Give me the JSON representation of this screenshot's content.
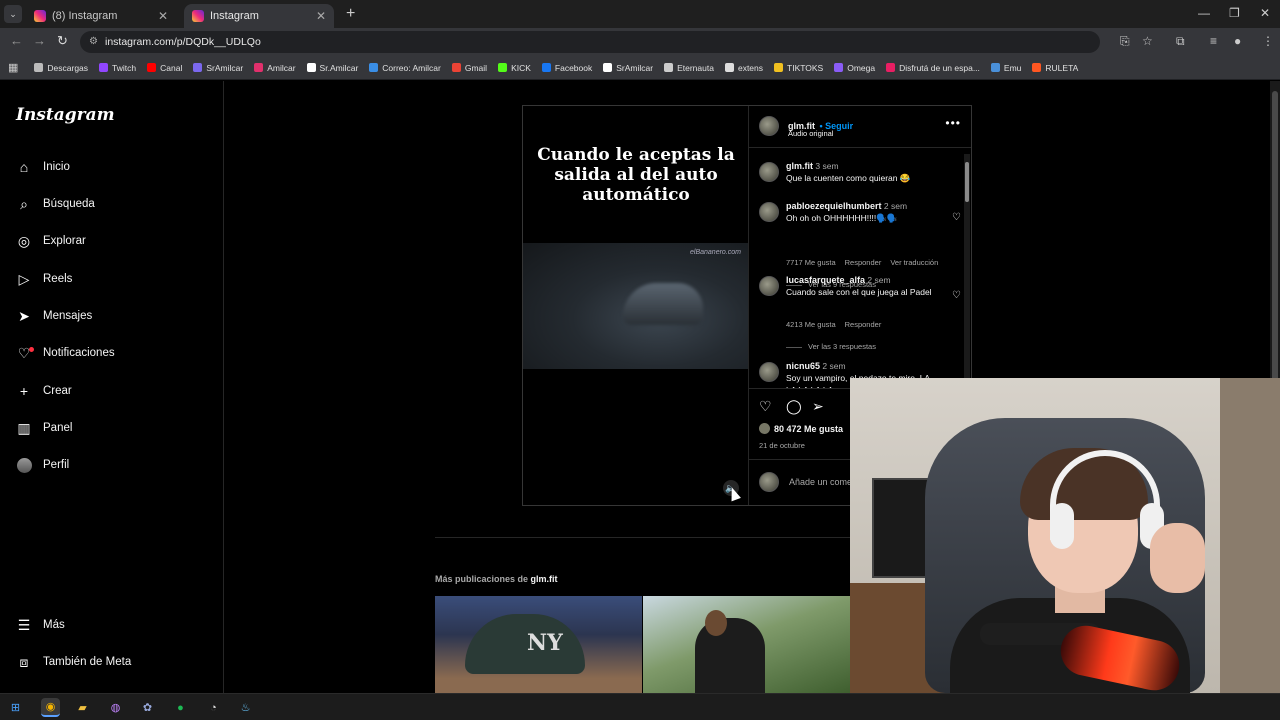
{
  "browser": {
    "tabs": [
      {
        "label": "(8) Instagram",
        "active": false
      },
      {
        "label": "Instagram",
        "active": true
      }
    ],
    "url": "instagram.com/p/DQDk__UDLQo",
    "bookmarks": [
      {
        "label": "Descargas",
        "color": "#bbbbbb"
      },
      {
        "label": "Twitch",
        "color": "#9146ff"
      },
      {
        "label": "Canal",
        "color": "#ff0000"
      },
      {
        "label": "SrAmilcar",
        "color": "#7b68ee"
      },
      {
        "label": "Amilcar",
        "color": "#e1306c"
      },
      {
        "label": "Sr.Amilcar",
        "color": "#ffffff"
      },
      {
        "label": "Correo: Amilcar",
        "color": "#3a8ee6"
      },
      {
        "label": "Gmail",
        "color": "#ea4335"
      },
      {
        "label": "KICK",
        "color": "#53fc18"
      },
      {
        "label": "Facebook",
        "color": "#1877f2"
      },
      {
        "label": "SrAmilcar",
        "color": "#ffffff"
      },
      {
        "label": "Eternauta",
        "color": "#cccccc"
      },
      {
        "label": "extens",
        "color": "#dddddd"
      },
      {
        "label": "TIKTOKS",
        "color": "#f0c020"
      },
      {
        "label": "Omega",
        "color": "#8a5cf6"
      },
      {
        "label": "Disfrutá de un espa...",
        "color": "#e91e63"
      },
      {
        "label": "Emu",
        "color": "#4a90d9"
      },
      {
        "label": "RULETA",
        "color": "#ff5722"
      }
    ]
  },
  "sidebar": {
    "logo": "Instagram",
    "items": [
      {
        "label": "Inicio",
        "icon": "home-icon",
        "glyph": "⌂"
      },
      {
        "label": "Búsqueda",
        "icon": "search-icon",
        "glyph": "⌕"
      },
      {
        "label": "Explorar",
        "icon": "compass-icon",
        "glyph": "◎"
      },
      {
        "label": "Reels",
        "icon": "reels-icon",
        "glyph": "▷"
      },
      {
        "label": "Mensajes",
        "icon": "messenger-icon",
        "glyph": "➤"
      },
      {
        "label": "Notificaciones",
        "icon": "heart-icon",
        "glyph": "♡"
      },
      {
        "label": "Crear",
        "icon": "plus-icon",
        "glyph": "+"
      },
      {
        "label": "Panel",
        "icon": "dashboard-icon",
        "glyph": "▥"
      },
      {
        "label": "Perfil",
        "icon": "profile-avatar",
        "glyph": ""
      }
    ],
    "more": "Más",
    "meta": "También de Meta"
  },
  "post": {
    "media_caption": "Cuando le aceptas la salida al del auto automático",
    "watermark": "elBananero.com",
    "username": "glm.fit",
    "follow": "Seguir",
    "audio": "Audio original",
    "comments": [
      {
        "user": "glm.fit",
        "time": "3 sem",
        "text": "Que la cuenten como quieran 😂",
        "likes": "",
        "reply": "",
        "translate": "",
        "replies": ""
      },
      {
        "user": "pabloezequielhumbert",
        "time": "2 sem",
        "text": "Oh oh oh OHHHHHH!!!!🗣️🗣️",
        "likes": "7717 Me gusta",
        "reply": "Responder",
        "translate": "Ver traducción",
        "replies": "Ver las 9 respuestas"
      },
      {
        "user": "lucasfarquete_alfa",
        "time": "2 sem",
        "text": "Cuando sale con el que juega al Padel",
        "likes": "4213 Me gusta",
        "reply": "Responder",
        "translate": "",
        "replies": "Ver las 3 respuestas"
      },
      {
        "user": "nicnu65",
        "time": "2 sem",
        "text": "Soy un vampiro, el pedazo te miro, LA LA LA LA LA",
        "likes": "",
        "reply": "",
        "translate": "",
        "replies": ""
      }
    ],
    "likes": "80 472 Me gusta",
    "date": "21 de octubre",
    "comment_placeholder": "Añade un comentario..."
  },
  "more_posts": {
    "prefix": "Más publicaciones de",
    "user": "glm.fit"
  }
}
